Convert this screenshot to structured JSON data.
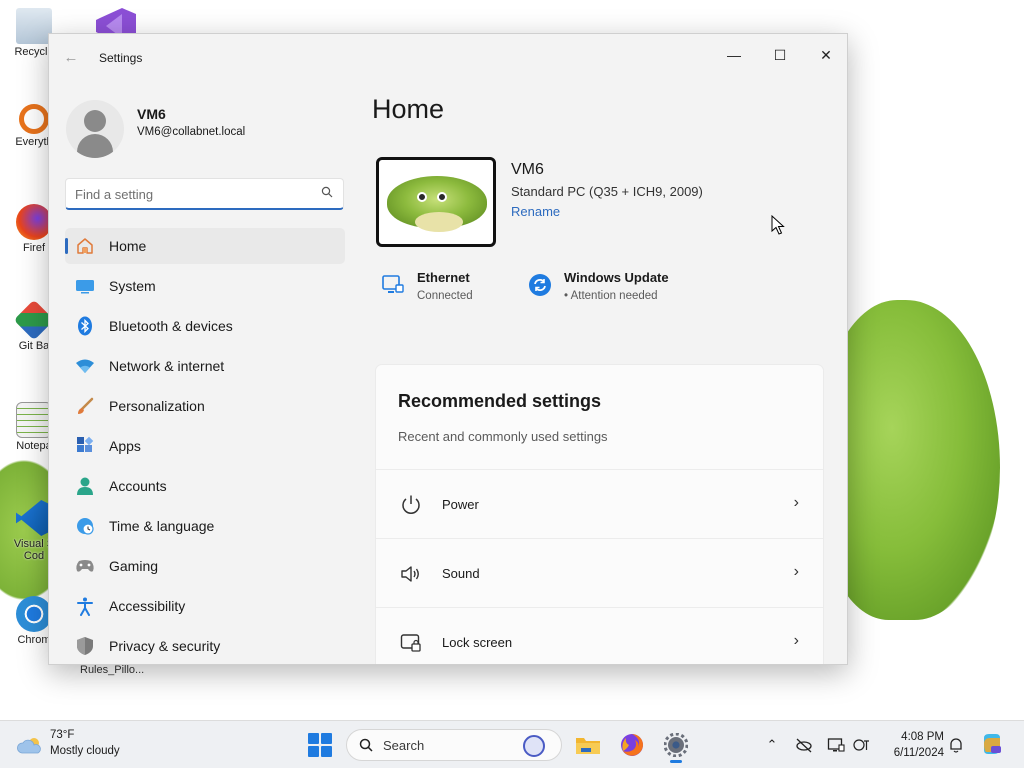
{
  "desktop": {
    "icons": [
      {
        "label": "Recycle",
        "name": "recycle-bin-icon"
      },
      {
        "label": "Everyth",
        "name": "everything-icon"
      },
      {
        "label": "Firef",
        "name": "firefox-icon"
      },
      {
        "label": "Git Ba",
        "name": "git-bash-icon"
      },
      {
        "label": "Notepa",
        "name": "notepad-icon"
      },
      {
        "label": "Visual S",
        "name": "vscode-icon"
      },
      {
        "label": "Chrom",
        "name": "chrome-icon"
      }
    ],
    "bottom_label": "Rules_Pillo...",
    "vs_sublabel": "Cod"
  },
  "window": {
    "title": "Settings",
    "controls": {
      "minimize": "—",
      "maximize": "☐",
      "close": "✕"
    }
  },
  "user": {
    "name": "VM6",
    "email": "VM6@collabnet.local"
  },
  "search": {
    "placeholder": "Find a setting",
    "value": ""
  },
  "nav": {
    "items": [
      {
        "label": "Home",
        "icon": "home-icon",
        "active": true
      },
      {
        "label": "System",
        "icon": "system-icon"
      },
      {
        "label": "Bluetooth & devices",
        "icon": "bluetooth-icon"
      },
      {
        "label": "Network & internet",
        "icon": "network-icon"
      },
      {
        "label": "Personalization",
        "icon": "brush-icon"
      },
      {
        "label": "Apps",
        "icon": "apps-icon"
      },
      {
        "label": "Accounts",
        "icon": "accounts-icon"
      },
      {
        "label": "Time & language",
        "icon": "globe-clock-icon"
      },
      {
        "label": "Gaming",
        "icon": "gamepad-icon"
      },
      {
        "label": "Accessibility",
        "icon": "accessibility-icon"
      },
      {
        "label": "Privacy & security",
        "icon": "shield-icon"
      }
    ]
  },
  "main": {
    "title": "Home",
    "device": {
      "name": "VM6",
      "spec": "Standard PC (Q35 + ICH9, 2009)",
      "rename": "Rename"
    },
    "status": {
      "ethernet": {
        "title": "Ethernet",
        "sub": "Connected"
      },
      "update": {
        "title": "Windows Update",
        "sub": "• Attention needed"
      }
    },
    "recommended": {
      "title": "Recommended settings",
      "subtitle": "Recent and commonly used settings",
      "items": [
        {
          "label": "Power",
          "icon": "power-icon"
        },
        {
          "label": "Sound",
          "icon": "speaker-icon"
        },
        {
          "label": "Lock screen",
          "icon": "lock-screen-icon"
        }
      ]
    }
  },
  "taskbar": {
    "weather": {
      "temp": "73°F",
      "condition": "Mostly cloudy"
    },
    "search_label": "Search",
    "clock": {
      "time": "4:08 PM",
      "date": "6/11/2024"
    }
  },
  "colors": {
    "accent": "#2d6bbf",
    "window_bg": "#f3f3f3",
    "card_bg": "#fbfbfb",
    "taskbar_bg": "#eef0f3"
  }
}
